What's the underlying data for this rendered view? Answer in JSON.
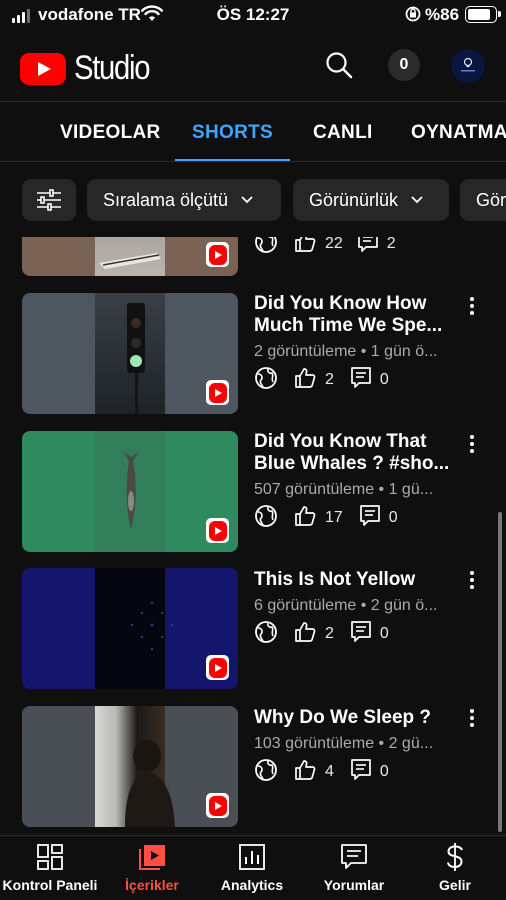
{
  "status_bar": {
    "carrier": "vodafone TR",
    "time": "ÖS 12:27",
    "battery": "%86",
    "battery_level": 0.86
  },
  "header": {
    "brand": "Studio",
    "notification_count": "0"
  },
  "tabs": [
    {
      "label": "VIDEOLAR",
      "active": false
    },
    {
      "label": "SHORTS",
      "active": true
    },
    {
      "label": "CANLI",
      "active": false
    },
    {
      "label": "OYNATMA",
      "active": false
    }
  ],
  "filters": [
    {
      "label": "Sıralama ölçütü"
    },
    {
      "label": "Görünürlük"
    },
    {
      "label": "Gör"
    }
  ],
  "partial_item": {
    "likes": "22",
    "comments": "2"
  },
  "videos": [
    {
      "title_line1": "Did You Know How",
      "title_line2": "Much Time We Spe...",
      "meta": "2 görüntüleme • 1 gün ö...",
      "likes": "2",
      "comments": "0"
    },
    {
      "title_line1": "Did You Know That",
      "title_line2": "Blue Whales ? #sho...",
      "meta": "507 görüntüleme • 1 gü...",
      "likes": "17",
      "comments": "0"
    },
    {
      "title_line1": "This Is Not Yellow",
      "title_line2": "",
      "meta": "6 görüntüleme • 2 gün ö...",
      "likes": "2",
      "comments": "0"
    },
    {
      "title_line1": "Why Do We Sleep ?",
      "title_line2": "",
      "meta": "103 görüntüleme • 2 gü...",
      "likes": "4",
      "comments": "0"
    }
  ],
  "bottom_nav": [
    {
      "label": "Kontrol Paneli",
      "icon": "dashboard-icon",
      "active": false
    },
    {
      "label": "İçerikler",
      "icon": "content-icon",
      "active": true
    },
    {
      "label": "Analytics",
      "icon": "analytics-icon",
      "active": false
    },
    {
      "label": "Yorumlar",
      "icon": "comments-icon",
      "active": false
    },
    {
      "label": "Gelir",
      "icon": "dollar-icon",
      "active": false
    }
  ],
  "colors": {
    "background": "#0f0f0f",
    "active_tab": "#3ea6ff",
    "active_nav": "#ff4e45",
    "brand_red": "#ff0000"
  }
}
